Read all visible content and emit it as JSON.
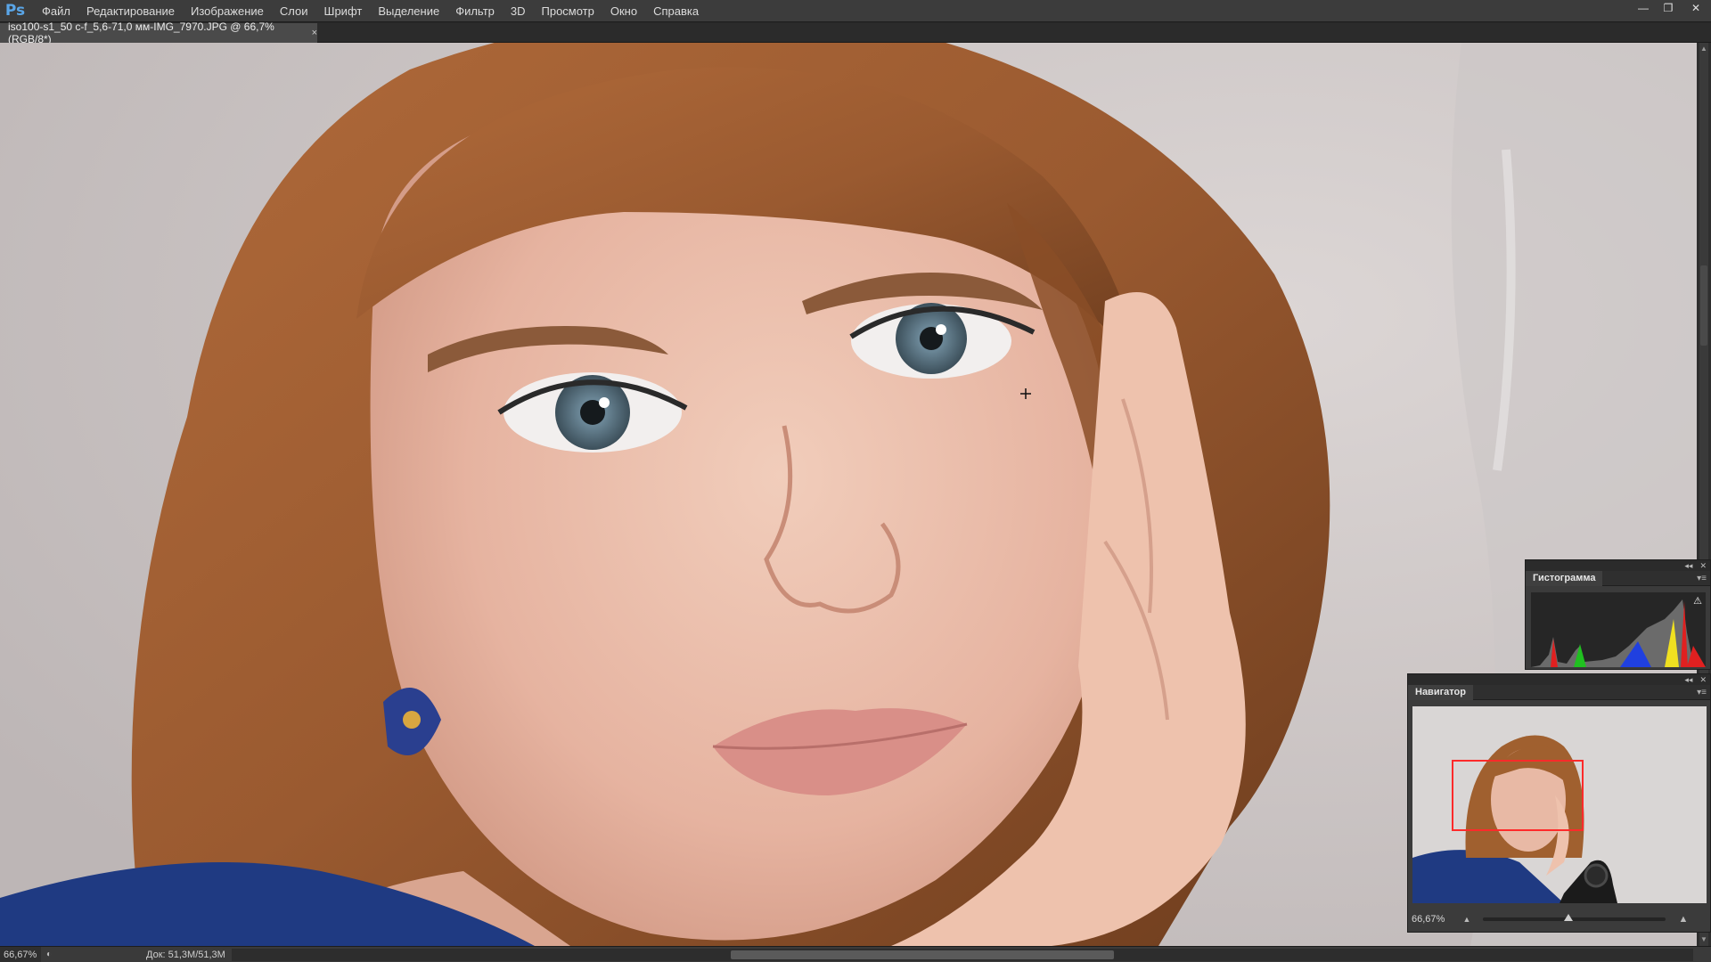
{
  "app": {
    "logo": "Ps"
  },
  "menu": {
    "items": [
      "Файл",
      "Редактирование",
      "Изображение",
      "Слои",
      "Шрифт",
      "Выделение",
      "Фильтр",
      "3D",
      "Просмотр",
      "Окно",
      "Справка"
    ]
  },
  "window_controls": {
    "minimize": "—",
    "restore": "❐",
    "close": "✕"
  },
  "document": {
    "tab_title": "iso100-s1_50 c-f_5,6-71,0 мм-IMG_7970.JPG @ 66,7% (RGB/8*)",
    "tab_close": "×"
  },
  "status": {
    "zoom": "66,67%",
    "doc_info": "Док: 51,3M/51,3M",
    "arrow": "▶"
  },
  "panels": {
    "histogram": {
      "tab": "Гистограмма",
      "warning_icon": "warning-icon"
    },
    "navigator": {
      "tab": "Навигатор",
      "zoom": "66,67%",
      "zoom_level_fraction": 0.47
    }
  },
  "colors": {
    "menubar_bg": "#3c3c3c",
    "panel_bg": "#3b3b3b",
    "nav_view_box": "#ff2a2a",
    "ps_logo": "#5aa6e8"
  }
}
